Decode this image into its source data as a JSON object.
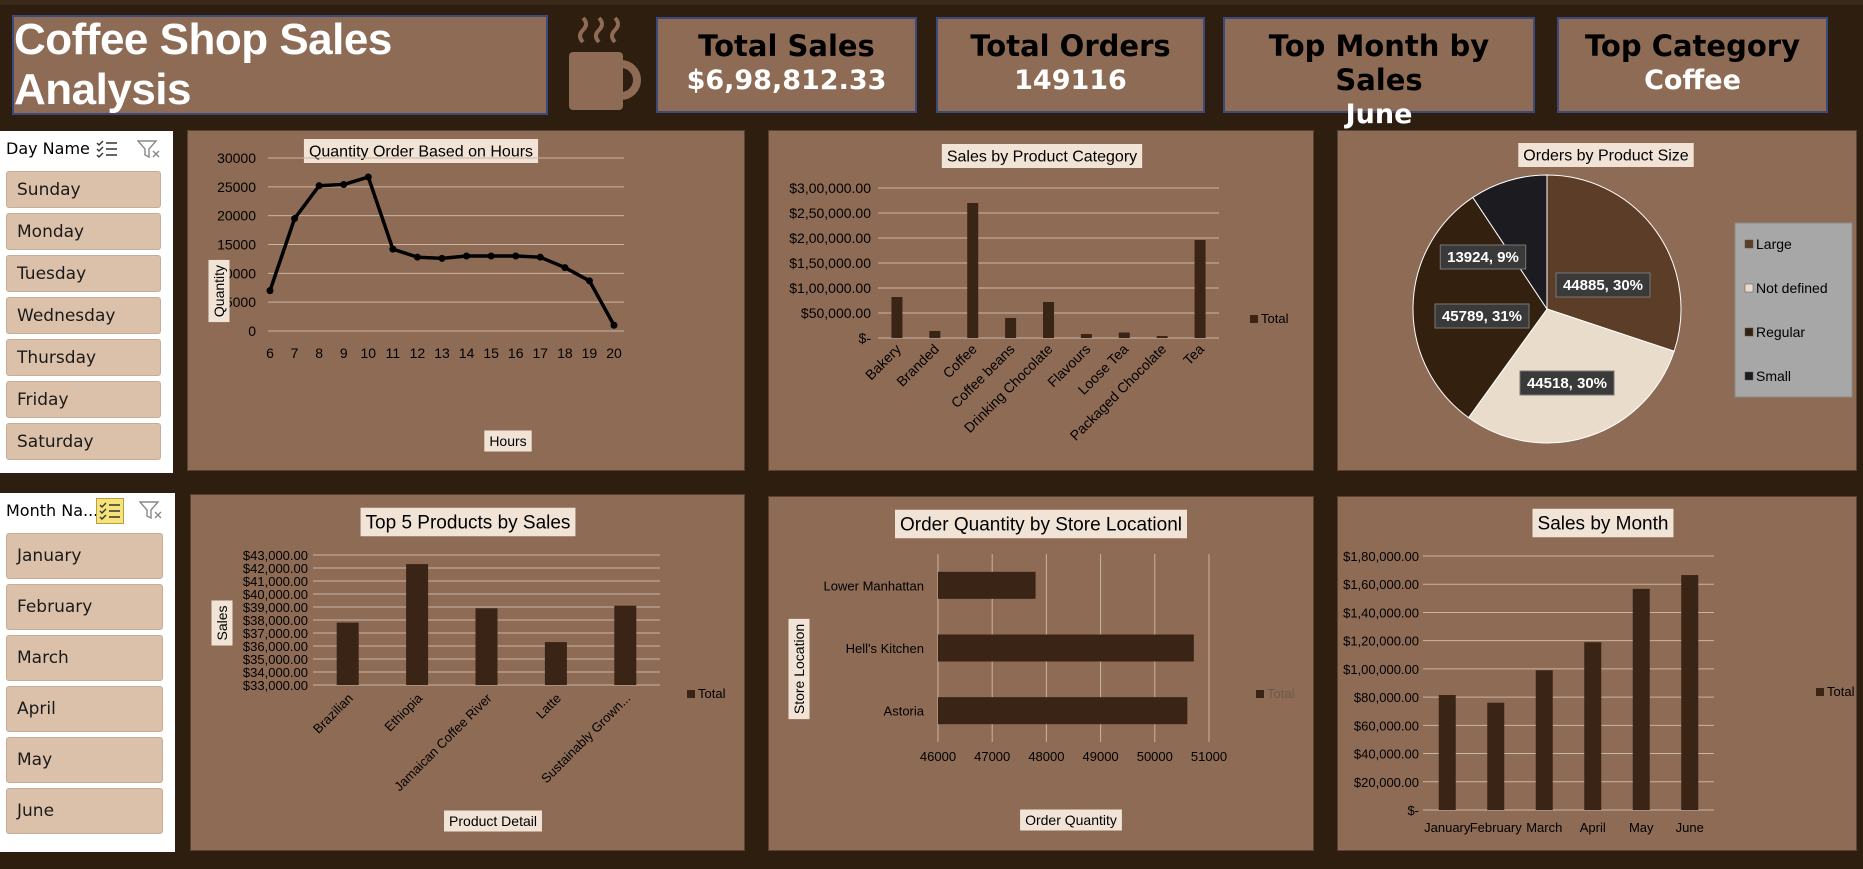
{
  "title": "Coffee Shop Sales Analysis",
  "kpis": [
    {
      "label": "Total Sales",
      "value": "$6,98,812.33"
    },
    {
      "label": "Total Orders",
      "value": "149116"
    },
    {
      "label": "Top Month by Sales",
      "value": "June"
    },
    {
      "label": "Top Category",
      "value": "Coffee"
    }
  ],
  "day_slicer": {
    "header": "Day Name",
    "items": [
      "Sunday",
      "Monday",
      "Tuesday",
      "Wednesday",
      "Thursday",
      "Friday",
      "Saturday"
    ]
  },
  "month_slicer": {
    "header": "Month Na...",
    "items": [
      "January",
      "February",
      "March",
      "April",
      "May",
      "June"
    ]
  },
  "icons": [
    "coffee-cup-icon",
    "multi-select-icon",
    "clear-filter-icon"
  ],
  "colors": {
    "background": "#2e1e10",
    "panel": "#8e6b55",
    "bar": "#3a2415",
    "label_bg": "#f1e4d6",
    "slicer_item": "#dcc1aa"
  },
  "chart_data": [
    {
      "type": "line",
      "title": "Quantity Order Based on Hours",
      "xlabel": "Hours",
      "ylabel": "Quantity",
      "x": [
        "6",
        "7",
        "8",
        "9",
        "10",
        "11",
        "12",
        "13",
        "14",
        "15",
        "16",
        "17",
        "18",
        "19",
        "20"
      ],
      "values": [
        7000,
        19500,
        25200,
        25400,
        26700,
        14200,
        12800,
        12600,
        13000,
        13000,
        13000,
        12800,
        11000,
        8700,
        1000
      ],
      "ylim": [
        0,
        30000
      ],
      "yticks": [
        "30000",
        "25000",
        "20000",
        "15000",
        "10000",
        "5000",
        "0"
      ],
      "grid": true
    },
    {
      "type": "bar",
      "title": "Sales by Product Category",
      "categories": [
        "Bakery",
        "Branded",
        "Coffee",
        "Coffee beans",
        "Drinking Chocolate",
        "Flavours",
        "Loose Tea",
        "Packaged Chocolate",
        "Tea"
      ],
      "values": [
        82000,
        14000,
        270000,
        40000,
        72000,
        8000,
        11000,
        4000,
        196000
      ],
      "legend": "Total",
      "ylim": [
        0,
        300000
      ],
      "yticks": [
        "$3,00,000.00",
        "$2,50,000.00",
        "$2,00,000.00",
        "$1,50,000.00",
        "$1,00,000.00",
        "$50,000.00",
        "$-"
      ],
      "grid": true
    },
    {
      "type": "pie",
      "title": "Orders by Product Size",
      "slices": [
        {
          "name": "Large",
          "value": 44885,
          "label": "44885, 30%",
          "color": "#5c3d28"
        },
        {
          "name": "Not defined",
          "value": 44518,
          "label": "44518, 30%",
          "color": "#eadccb"
        },
        {
          "name": "Regular",
          "value": 45789,
          "label": "45789, 31%",
          "color": "#33200f"
        },
        {
          "name": "Small",
          "value": 13924,
          "label": "13924, 9%",
          "color": "#1c1b20"
        }
      ]
    },
    {
      "type": "bar",
      "title": "Top 5 Products by Sales",
      "xlabel": "Product Detail",
      "ylabel": "Sales",
      "categories": [
        "Brazilian",
        "Ethiopia",
        "Jamaican Coffee River",
        "Latte",
        "Sustainably Grown..."
      ],
      "values": [
        37800,
        42300,
        38900,
        36300,
        39100
      ],
      "legend": "Total",
      "ylim": [
        33000,
        43000
      ],
      "yticks": [
        "$43,000.00",
        "$42,000.00",
        "$41,000.00",
        "$40,000.00",
        "$39,000.00",
        "$38,000.00",
        "$37,000.00",
        "$36,000.00",
        "$35,000.00",
        "$34,000.00",
        "$33,000.00"
      ],
      "grid": true
    },
    {
      "type": "bar",
      "orientation": "horizontal",
      "title": "Order Quantity by Store Locationl",
      "xlabel": "Order Quantity",
      "ylabel": "Store Location",
      "categories": [
        "Lower Manhattan",
        "Hell's Kitchen",
        "Astoria"
      ],
      "values": [
        47800,
        50720,
        50600
      ],
      "legend": "Total",
      "xlim": [
        46000,
        51000
      ],
      "xticks": [
        "46000",
        "47000",
        "48000",
        "49000",
        "50000",
        "51000"
      ],
      "grid": true
    },
    {
      "type": "bar",
      "title": "Sales by Month",
      "categories": [
        "January",
        "February",
        "March",
        "April",
        "May",
        "June"
      ],
      "values": [
        81500,
        76000,
        99000,
        118900,
        156700,
        166500
      ],
      "legend": "Total",
      "ylim": [
        0,
        180000
      ],
      "yticks": [
        "$1,80,000.00",
        "$1,60,000.00",
        "$1,40,000.00",
        "$1,20,000.00",
        "$1,00,000.00",
        "$80,000.00",
        "$60,000.00",
        "$40,000.00",
        "$20,000.00",
        "$-"
      ],
      "grid": true
    }
  ]
}
